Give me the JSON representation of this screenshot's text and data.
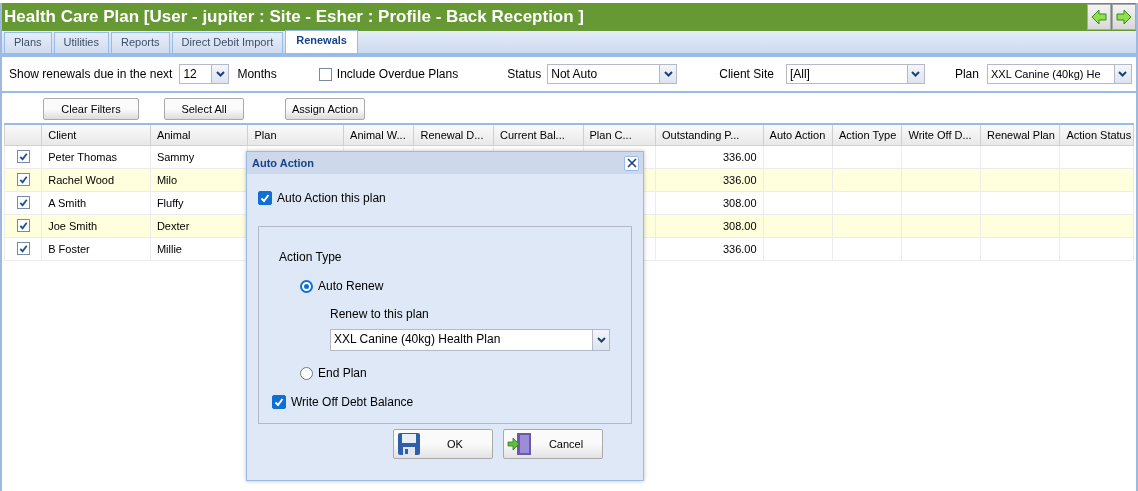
{
  "window": {
    "title": "Health Care Plan [User - jupiter : Site - Esher : Profile - Back Reception ]"
  },
  "tabs": [
    {
      "label": "Plans",
      "selected": false
    },
    {
      "label": "Utilities",
      "selected": false
    },
    {
      "label": "Reports",
      "selected": false
    },
    {
      "label": "Direct Debit Import",
      "selected": false
    },
    {
      "label": "Renewals",
      "selected": true
    }
  ],
  "filters": {
    "due_label": "Show renewals due in the next",
    "due_value": "12",
    "months_label": "Months",
    "overdue": {
      "label": "Include Overdue Plans",
      "checked": false
    },
    "status_label": "Status",
    "status_value": "Not Auto",
    "site_label": "Client Site",
    "site_value": "[All]",
    "plan_label": "Plan",
    "plan_value": "XXL Canine (40kg) He"
  },
  "buttons": [
    "Clear Filters",
    "Select All",
    "Assign Action"
  ],
  "table": {
    "columns": [
      "Client",
      "Animal",
      "Plan",
      "Animal W...",
      "Renewal D...",
      "Current Bal...",
      "Plan C...",
      "Outstanding P...",
      "Auto Action",
      "Action Type",
      "Write Off D...",
      "Renewal Plan",
      "Action Status"
    ],
    "rows": [
      {
        "checked": true,
        "client": "Peter Thomas",
        "animal": "Sammy",
        "outstanding": "336.00"
      },
      {
        "checked": true,
        "client": "Rachel Wood",
        "animal": "Milo",
        "outstanding": "336.00"
      },
      {
        "checked": true,
        "client": "A Smith",
        "animal": "Fluffy",
        "outstanding": "308.00"
      },
      {
        "checked": true,
        "client": "Joe Smith",
        "animal": "Dexter",
        "outstanding": "308.00"
      },
      {
        "checked": true,
        "client": "B Foster",
        "animal": "Millie",
        "outstanding": "336.00"
      }
    ]
  },
  "dialog": {
    "title": "Auto Action",
    "auto_action": {
      "label": "Auto Action this plan",
      "checked": true
    },
    "action_type_label": "Action Type",
    "options": [
      {
        "label": "Auto Renew",
        "selected": true
      },
      {
        "label": "End Plan",
        "selected": false
      }
    ],
    "renew_label": "Renew to this plan",
    "renew_value": "XXL Canine (40kg) Health Plan",
    "write_off": {
      "label": "Write Off Debt Balance",
      "checked": true
    },
    "buttons": [
      {
        "label": "OK",
        "kind": "save"
      },
      {
        "label": "Cancel",
        "kind": "exit"
      }
    ]
  }
}
